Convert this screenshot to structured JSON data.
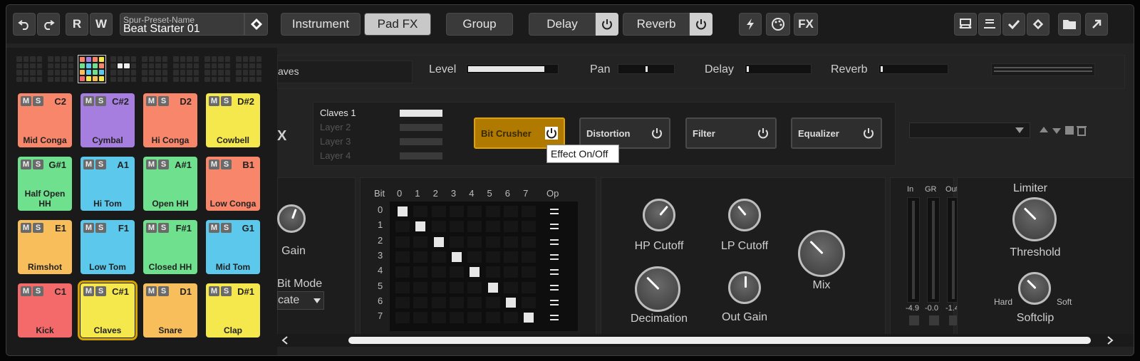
{
  "toolbar": {
    "undo_icon": "undo-icon",
    "redo_icon": "redo-icon",
    "r_label": "R",
    "w_label": "W",
    "preset_label": "Spur-Preset-Name",
    "preset_value": "Beat Starter 01",
    "tabs": [
      "Instrument",
      "Pad FX"
    ],
    "group_label": "Group",
    "delay_label": "Delay",
    "reverb_label": "Reverb",
    "fx_label": "FX"
  },
  "pads": [
    {
      "note": "C2",
      "name": "Mid Conga",
      "color": "#f8866a"
    },
    {
      "note": "C#2",
      "name": "Cymbal",
      "color": "#a67ee0"
    },
    {
      "note": "D2",
      "name": "Hi Conga",
      "color": "#f8866a"
    },
    {
      "note": "D#2",
      "name": "Cowbell",
      "color": "#f5e84c"
    },
    {
      "note": "G#1",
      "name": "Half Open HH",
      "color": "#6fe08e"
    },
    {
      "note": "A1",
      "name": "Hi Tom",
      "color": "#5cc8ec"
    },
    {
      "note": "A#1",
      "name": "Open HH",
      "color": "#6fe08e"
    },
    {
      "note": "B1",
      "name": "Low Conga",
      "color": "#f8866a"
    },
    {
      "note": "E1",
      "name": "Rimshot",
      "color": "#f9be5c"
    },
    {
      "note": "F1",
      "name": "Low Tom",
      "color": "#5cc8ec"
    },
    {
      "note": "F#1",
      "name": "Closed HH",
      "color": "#6fe08e"
    },
    {
      "note": "G1",
      "name": "Mid Tom",
      "color": "#5cc8ec"
    },
    {
      "note": "C1",
      "name": "Kick",
      "color": "#f46a6a"
    },
    {
      "note": "C#1",
      "name": "Claves",
      "color": "#f5e84c"
    },
    {
      "note": "D1",
      "name": "Snare",
      "color": "#f9be5c"
    },
    {
      "note": "D#1",
      "name": "Clap",
      "color": "#f5e84c"
    }
  ],
  "pad_ms": {
    "m": "M",
    "s": "S"
  },
  "mixer": {
    "pad_name": "aves",
    "level_label": "Level",
    "level": 0.85,
    "pan_label": "Pan",
    "pan": 0.5,
    "delay_label": "Delay",
    "delay": 0.02,
    "reverb_label": "Reverb",
    "reverb": 0.02
  },
  "fx_section": {
    "x_label": "X",
    "layers": [
      "Claves 1",
      "Layer 2",
      "Layer 3",
      "Layer 4"
    ],
    "effects": [
      "Bit Crusher",
      "Distortion",
      "Filter",
      "Equalizer"
    ],
    "tooltip": "Effect On/Off"
  },
  "bitcrusher": {
    "gain_label": "Gain",
    "bitmode_label": "Bit Mode",
    "bitmode_value": "cate",
    "bit_header": "Bit",
    "op_header": "Op",
    "bits": [
      "0",
      "1",
      "2",
      "3",
      "4",
      "5",
      "6",
      "7"
    ],
    "rows": [
      "0",
      "1",
      "2",
      "3",
      "4",
      "5",
      "6",
      "7"
    ],
    "hp_label": "HP Cutoff",
    "lp_label": "LP Cutoff",
    "decimation_label": "Decimation",
    "outgain_label": "Out Gain",
    "mix_label": "Mix"
  },
  "meters": {
    "in_label": "In",
    "gr_label": "GR",
    "out_label": "Out",
    "in_value": "-4.9",
    "gr_value": "-0.0",
    "out_value": "-1.4"
  },
  "limiter": {
    "title": "Limiter",
    "threshold_label": "Threshold",
    "hard_label": "Hard",
    "soft_label": "Soft",
    "softclip_label": "Softclip"
  }
}
